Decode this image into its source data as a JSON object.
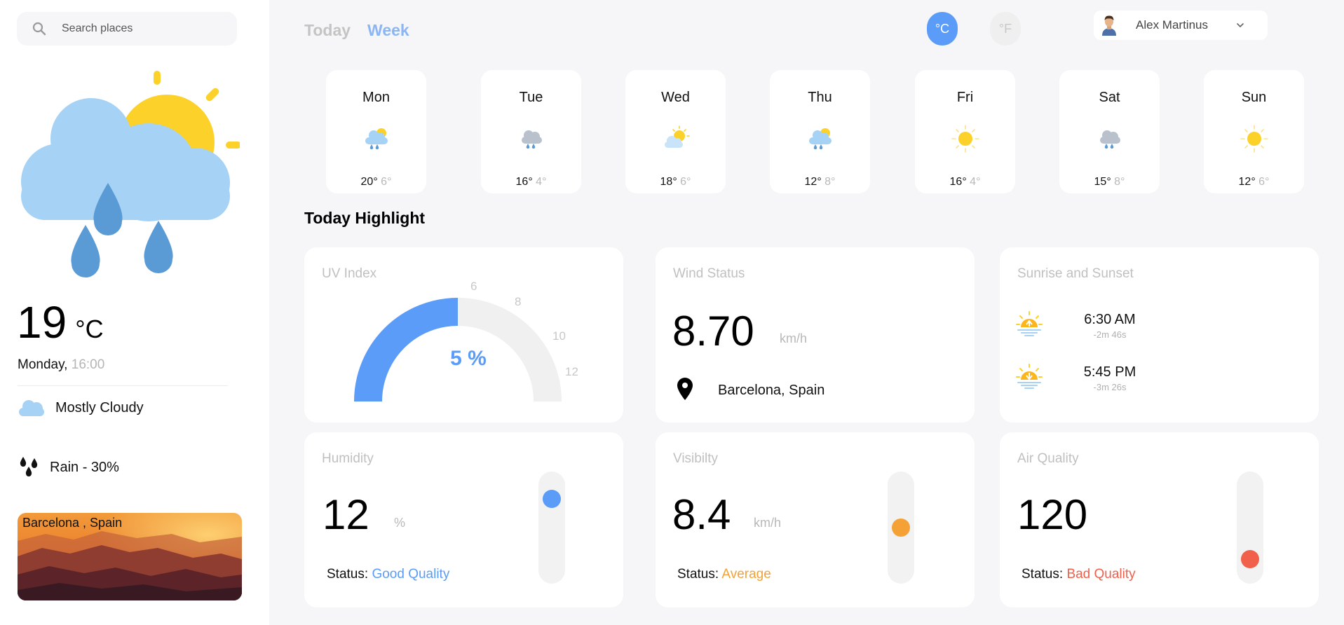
{
  "search": {
    "placeholder": "Search places"
  },
  "current": {
    "temperature": "19",
    "unit": "°C",
    "day": "Monday,",
    "time": "16:00",
    "condition": "Mostly Cloudy",
    "rain": "Rain - 30%",
    "city_image_label": "Barcelona , Spain"
  },
  "tabs": {
    "today": "Today",
    "week": "Week",
    "active": "Week"
  },
  "units": {
    "celsius": "°C",
    "fahrenheit": "°F",
    "active": "celsius"
  },
  "profile": {
    "name": "Alex Martinus"
  },
  "week": [
    {
      "day": "Mon",
      "hi": "20°",
      "lo": "6°",
      "icon": "rain-sun-icon"
    },
    {
      "day": "Tue",
      "hi": "16°",
      "lo": "4°",
      "icon": "rain-cloud-icon"
    },
    {
      "day": "Wed",
      "hi": "18°",
      "lo": "6°",
      "icon": "partly-cloudy-icon"
    },
    {
      "day": "Thu",
      "hi": "12°",
      "lo": "8°",
      "icon": "rain-sun-icon"
    },
    {
      "day": "Fri",
      "hi": "16°",
      "lo": "4°",
      "icon": "sun-icon"
    },
    {
      "day": "Sat",
      "hi": "15°",
      "lo": "8°",
      "icon": "rain-cloud-icon"
    },
    {
      "day": "Sun",
      "hi": "12°",
      "lo": "6°",
      "icon": "sun-icon"
    }
  ],
  "highlight": {
    "title": "Today Highlight",
    "uv": {
      "title": "UV Index",
      "value": "5 %",
      "level": 5,
      "scale_max": 12,
      "ticks": [
        "6",
        "8",
        "10",
        "12"
      ]
    },
    "wind": {
      "title": "Wind Status",
      "value": "8.70",
      "unit": "km/h",
      "location": "Barcelona, Spain"
    },
    "sun": {
      "title": "Sunrise and Sunset",
      "sunrise": {
        "time": "6:30 AM",
        "delta": "-2m 46s"
      },
      "sunset": {
        "time": "5:45 PM",
        "delta": "-3m 26s"
      }
    },
    "humidity": {
      "title": "Humidity",
      "value": "12",
      "unit": "%",
      "status_label": "Status:",
      "status": "Good Quality",
      "status_color": "#5a9cf8",
      "level": 0.85
    },
    "visibility": {
      "title": "Visibilty",
      "value": "8.4",
      "unit": "km/h",
      "status_label": "Status:",
      "status": "Average",
      "status_color": "#f4a236",
      "level": 0.5
    },
    "air": {
      "title": "Air Quality",
      "value": "120",
      "status_label": "Status:",
      "status": "Bad Quality",
      "status_color": "#f0604a",
      "level": 0.12
    }
  },
  "colors": {
    "accent": "#5a9cf8",
    "sun": "#fcd12a",
    "cloud": "#a6d3f5",
    "drop": "#5a9bd5",
    "average": "#f4a236",
    "bad": "#f0604a"
  }
}
